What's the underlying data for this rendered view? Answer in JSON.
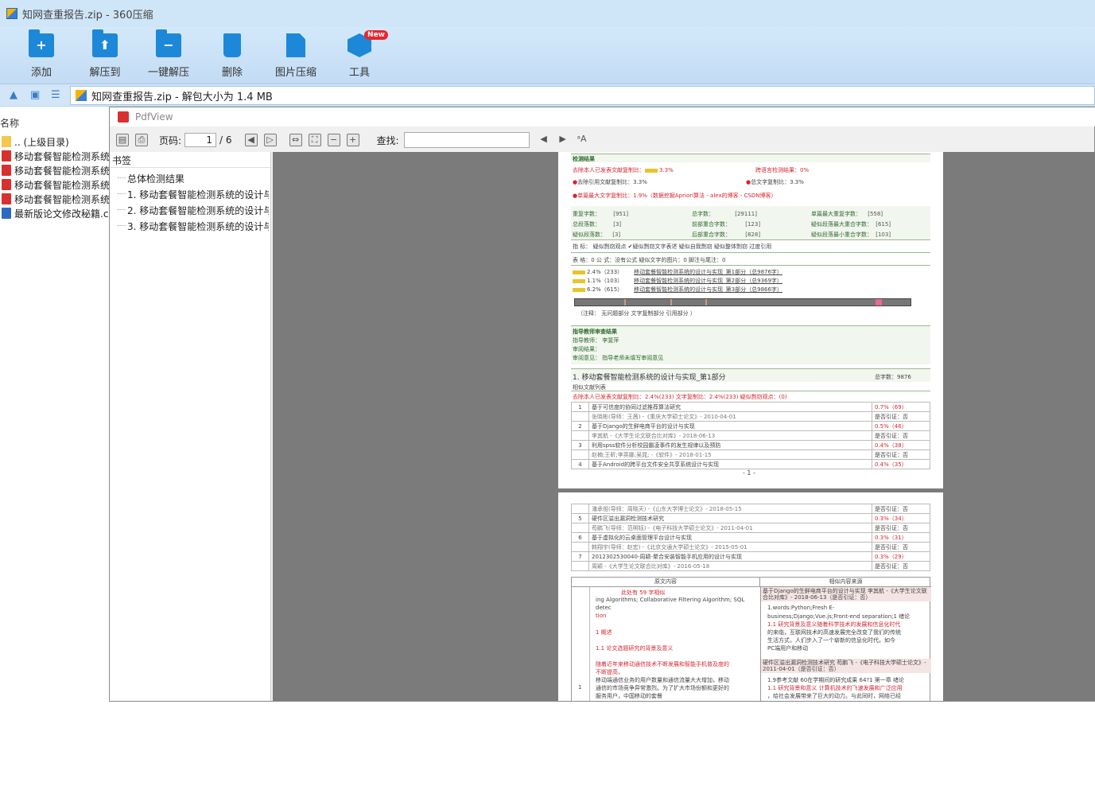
{
  "window": {
    "title": "知网查重报告.zip - 360压缩"
  },
  "toolbar": {
    "items": [
      {
        "label": "添加",
        "icon": "add-folder-icon"
      },
      {
        "label": "解压到",
        "icon": "extract-to-icon"
      },
      {
        "label": "一键解压",
        "icon": "one-click-extract-icon"
      },
      {
        "label": "删除",
        "icon": "delete-icon"
      },
      {
        "label": "图片压缩",
        "icon": "image-compress-icon"
      },
      {
        "label": "工具",
        "icon": "tools-icon",
        "badge": "New"
      }
    ]
  },
  "address": {
    "text": "知网查重报告.zip - 解包大小为 1.4 MB"
  },
  "filelist": {
    "header": "名称",
    "rows": [
      "..  (上级目录)",
      "移动套餐智能检测系统",
      "移动套餐智能检测系统",
      "移动套餐智能检测系统",
      "移动套餐智能检测系统",
      "最新版论文修改秘籍.c"
    ]
  },
  "pdfview": {
    "title": "PdfView",
    "page_label": "页码:",
    "page_value": "1",
    "page_total": "/ 6",
    "find_label": "查找:",
    "bookmarks_title": "书签",
    "bookmarks": [
      "总体检测结果",
      "1. 移动套餐智能检测系统的设计与",
      "2. 移动套餐智能检测系统的设计与",
      "3. 移动套餐智能检测系统的设计与"
    ]
  },
  "page1": {
    "section": "检测结果",
    "a": "去除本人已发表文献复制比：",
    "a_val": "3.3%",
    "b": "跨语言检测结果：0%",
    "c": "去除引用文献复制比：3.3%",
    "d": "总文字复制比：3.3%",
    "e": "单篇最大文字复制比：1.9%（数据挖掘Apriori算法 - alex的博客 - CSDN博客）",
    "stats": [
      [
        "重复字数：",
        "[951]",
        "总字数：",
        "[29111]",
        "单篇最大重复字数：",
        "[558]"
      ],
      [
        "总段落数：",
        "[3]",
        "前部重合字数：",
        "[123]",
        "疑似段落最大重合字数：",
        "[615]"
      ],
      [
        "疑似段落数：",
        "[3]",
        "后部重合字数：",
        "[828]",
        "疑似段落最小重合字数：",
        "[103]"
      ]
    ],
    "indicators": "指  标：  疑似剽窃观点   ✔疑似剽窃文字表述   疑似自我剽窃   疑似整体剽窃   过度引用",
    "tables": "表  格：0     公  式：没有公式     疑似文字的图片：0     脚注与尾注：0",
    "parts": [
      [
        "2.4%（233）",
        "移动套餐智能检测系统的设计与实现_第1部分（总9876字）"
      ],
      [
        "1.1%（103）",
        "移动套餐智能检测系统的设计与实现_第2部分（总9369字）"
      ],
      [
        "6.2%（615）",
        "移动套餐智能检测系统的设计与实现_第3部分（总9866字）"
      ]
    ],
    "legend": "（注释：    无问题部分     文字复制部分     引用部分 ）",
    "teacher_title": "指导教师审查结果",
    "teacher": "指导教师：     李斐萍",
    "review": "审阅结果：",
    "opinion": "审阅意见：     指导老师未填写审阅意见",
    "part_title": "1. 移动套餐智能检测系统的设计与实现_第1部分",
    "part_total": "总字数：9876",
    "similar": "相似文献列表",
    "part_stats": "去除本人已发表文献复制比：2.4%(233)     文字复制比：2.4%(233)     疑似剽窃观点：(0)",
    "refs": [
      [
        "1",
        "基于可信度的协同过滤推荐算法研究",
        "0.7%（69）",
        "张晓彬(导师：王茜) -《重庆大学硕士论文》- 2010-04-01",
        "是否引证：否"
      ],
      [
        "2",
        "基于Django的生鲜电商平台的设计与实现",
        "0.5%（46）",
        "李其航 -《大学生论文联合比对库》- 2018-06-13",
        "是否引证：否"
      ],
      [
        "3",
        "利用spss软件分析校园霸凌事件的发生规律以及预防",
        "0.4%（38）",
        "赵楠;王昕;李英娜;吴晁; -《软件》- 2018-01-15",
        "是否引证：否"
      ],
      [
        "4",
        "基于Android的跨平台文件安全共享系统设计与实现",
        "0.4%（35）",
        "",
        ""
      ]
    ],
    "page_no": "- 1 -"
  },
  "page2": {
    "refs": [
      [
        "",
        "潘承祖(导师：周晓天) -《山东大学博士论文》- 2018-05-15",
        "",
        "是否引证：否"
      ],
      [
        "5",
        "硬件区溢出漏洞检测技术研究",
        "0.3%（34）",
        ""
      ],
      [
        "",
        "苟鹏飞(导师：范明钰) -《电子科技大学硕士论文》- 2011-04-01",
        "",
        "是否引证：否"
      ],
      [
        "6",
        "基于虚拟化的云桌面管理平台设计与实现",
        "0.3%（31）",
        ""
      ],
      [
        "",
        "韩翔宇(导师：赵宏) -《北京交通大学硕士论文》- 2015-05-01",
        "",
        "是否引证：否"
      ],
      [
        "7",
        "2012302530040-周颖-聚合安装智能手机应用的设计与实现",
        "0.3%（29）",
        ""
      ],
      [
        "",
        "周颖 -《大学生论文联合比对库》- 2016-05-18",
        "",
        "是否引证：否"
      ]
    ],
    "col_left": "原文内容",
    "col_right": "相似内容来源",
    "left_lines": [
      "此处有 59 字相似",
      "ing Algorithms; Collaborative Filtering Algorithm; SQL",
      "detec",
      "tion",
      "",
      "1 概述",
      "",
      "1.1 论文选题研究的背景及意义",
      "",
      "随着近年来移动通信技术不断发展和智能手机普及度的",
      "不断提高，",
      "移动端通信业务的用户数量和通信流量大大增加，移动",
      "通信的市场竞争异常激烈。为了扩大市场份额和更好的",
      "服务用户，中国移动的套餐"
    ],
    "right_a": "基于Django的生鲜电商平台的设计与实现  李其航 -《大学生论文联合比对库》- 2018-06-13（是否引证：否）",
    "right_a_lines": [
      "1.words:Python;Fresh E-",
      "business;Django;Vue.js;Front-end separation;1 绪论",
      "1.1 研究背景及意义随着科学技术的发展和信息化时代",
      "的来临，互联网技术的高速发展完全改变了我们的传统",
      "生活方式，人们步入了一个崭新的信息化时代。如今",
      "PC端用户和移动"
    ],
    "right_b": "硬件区溢出漏洞检测技术研究  苟鹏飞 -《电子科技大学硕士论文》- 2011-04-01（是否引证：否）",
    "right_b_lines": [
      "1.9参考文献 60在学期间的研究成果 64?1 第一章 绪论",
      "1.1 研究背景和意义 计算机技术的飞速发展和广泛应用",
      "，给社会发展带来了巨大的动力。与此同时，网络已经"
    ],
    "row_no": "1"
  },
  "colors": {
    "accent": "#1e88d8",
    "red": "#d6262f",
    "green": "#2f6b2f",
    "viewer_bg": "#7b7b7b"
  }
}
